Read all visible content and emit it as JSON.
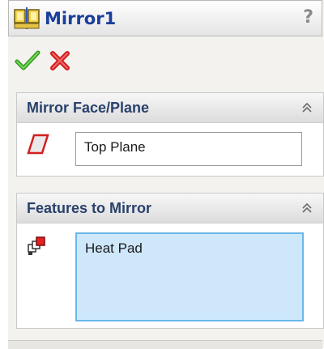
{
  "window": {
    "title": "Mirror1",
    "help_label": "?"
  },
  "actions": {
    "ok_icon": "checkmark-icon",
    "cancel_icon": "cross-icon"
  },
  "groups": [
    {
      "title": "Mirror Face/Plane",
      "icon": "plane-icon",
      "field_value": "Top Plane"
    },
    {
      "title": "Features to Mirror",
      "icon": "features-icon",
      "items": [
        "Heat Pad"
      ]
    }
  ],
  "colors": {
    "title_text": "#1a3f9a",
    "header_text": "#29416b",
    "ok_green": "#2c9a1a",
    "cancel_red": "#d21c1c",
    "selection_fill": "#cfe7fb",
    "selection_border": "#6ab7ea"
  }
}
